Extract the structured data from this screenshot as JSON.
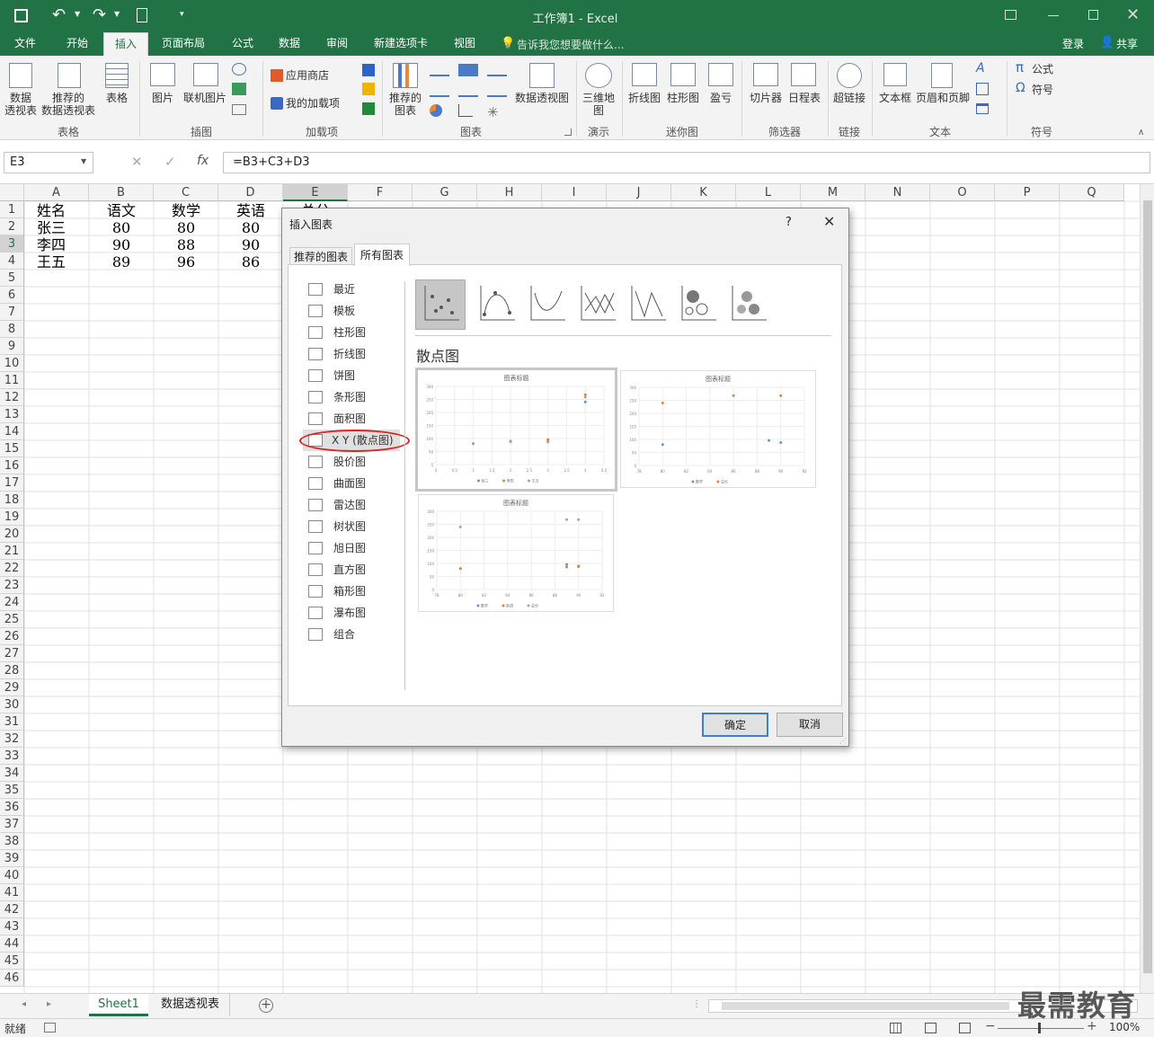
{
  "window": {
    "title": "工作簿1 - Excel"
  },
  "qat": {
    "save": "save-icon",
    "undo": "undo-icon",
    "redo": "redo-icon",
    "new": "new-doc-icon"
  },
  "tabs": [
    "文件",
    "开始",
    "插入",
    "页面布局",
    "公式",
    "数据",
    "审阅",
    "新建选项卡",
    "视图"
  ],
  "tell_me": "告诉我您想要做什么...",
  "account": {
    "login": "登录",
    "share": "共享"
  },
  "ribbon": {
    "tables": {
      "pivot": "数据\n透视表",
      "rec_pivot": "推荐的\n数据透视表",
      "table": "表格",
      "label": "表格"
    },
    "illustrations": {
      "picture": "图片",
      "online_picture": "联机图片",
      "label": "插图"
    },
    "addins": {
      "store": "应用商店",
      "my_addins": "我的加载项",
      "label": "加载项"
    },
    "charts": {
      "recommended": "推荐的\n图表",
      "pivot_chart": "数据透视图",
      "label": "图表"
    },
    "tours": {
      "map3d": "三维地\n图",
      "label": "演示"
    },
    "sparklines": {
      "line": "折线图",
      "column": "柱形图",
      "winloss": "盈亏",
      "label": "迷你图"
    },
    "filters": {
      "slicer": "切片器",
      "timeline": "日程表",
      "label": "筛选器"
    },
    "links": {
      "hyperlink": "超链接",
      "label": "链接"
    },
    "text": {
      "textbox": "文本框",
      "header_footer": "页眉和页脚",
      "label": "文本"
    },
    "symbols": {
      "equation": "公式",
      "symbol": "符号",
      "label": "符号"
    }
  },
  "formula_bar": {
    "name_box": "E3",
    "formula": "=B3+C3+D3"
  },
  "columns": [
    "A",
    "B",
    "C",
    "D",
    "E",
    "F",
    "G",
    "H",
    "I",
    "J",
    "K",
    "L",
    "M",
    "N",
    "O",
    "P",
    "Q"
  ],
  "rows": [
    "1",
    "2",
    "3",
    "4",
    "5",
    "6",
    "7",
    "8",
    "9",
    "10",
    "11",
    "12",
    "13",
    "14",
    "15",
    "16",
    "17",
    "18",
    "19",
    "20",
    "21",
    "22",
    "23",
    "24",
    "25",
    "26",
    "27",
    "28",
    "29",
    "30",
    "31",
    "32",
    "33",
    "34",
    "35",
    "36",
    "37",
    "38",
    "39",
    "40",
    "41",
    "42",
    "43",
    "44",
    "45",
    "46"
  ],
  "cells": [
    [
      "姓名",
      "语文",
      "数学",
      "英语",
      "总分"
    ],
    [
      "张三",
      "80",
      "80",
      "80"
    ],
    [
      "李四",
      "90",
      "88",
      "90"
    ],
    [
      "王五",
      "89",
      "96",
      "86"
    ]
  ],
  "dialog": {
    "title": "插入图表",
    "help": "?",
    "close": "close-icon",
    "tabs": [
      "推荐的图表",
      "所有图表"
    ],
    "categories": [
      "最近",
      "模板",
      "柱形图",
      "折线图",
      "饼图",
      "条形图",
      "面积图",
      "X Y (散点图)",
      "股价图",
      "曲面图",
      "雷达图",
      "树状图",
      "旭日图",
      "直方图",
      "箱形图",
      "瀑布图",
      "组合"
    ],
    "selected_category": "X Y (散点图)",
    "section_title": "散点图",
    "preview_title": "图表标题",
    "preview1": {
      "yticks": [
        "300",
        "250",
        "200",
        "150",
        "100",
        "50",
        "0"
      ],
      "xticks": [
        "0",
        "0.5",
        "1",
        "1.5",
        "2",
        "2.5",
        "3",
        "3.5",
        "4",
        "4.5"
      ],
      "legend": [
        "张三",
        "李四",
        "王五"
      ]
    },
    "preview2": {
      "yticks": [
        "300",
        "250",
        "200",
        "150",
        "100",
        "50",
        "0"
      ],
      "xticks": [
        "78",
        "80",
        "82",
        "84",
        "86",
        "88",
        "90",
        "92"
      ],
      "legend": [
        "数学",
        "总分"
      ]
    },
    "preview3": {
      "yticks": [
        "300",
        "250",
        "200",
        "150",
        "100",
        "50",
        "0"
      ],
      "xticks": [
        "78",
        "80",
        "82",
        "84",
        "86",
        "88",
        "90",
        "92"
      ],
      "legend": [
        "数学",
        "英语",
        "总分"
      ]
    },
    "ok": "确定",
    "cancel": "取消"
  },
  "sheets": [
    "Sheet1",
    "数据透视表"
  ],
  "status": {
    "ready": "就绪",
    "zoom": "100%"
  },
  "watermark": "最需教育",
  "colors": {
    "excel_green": "#217346",
    "series_blue": "#5b9bd5",
    "series_orange": "#ed7d31",
    "series_gray": "#a5a5a5",
    "highlight_red": "#e02020"
  }
}
